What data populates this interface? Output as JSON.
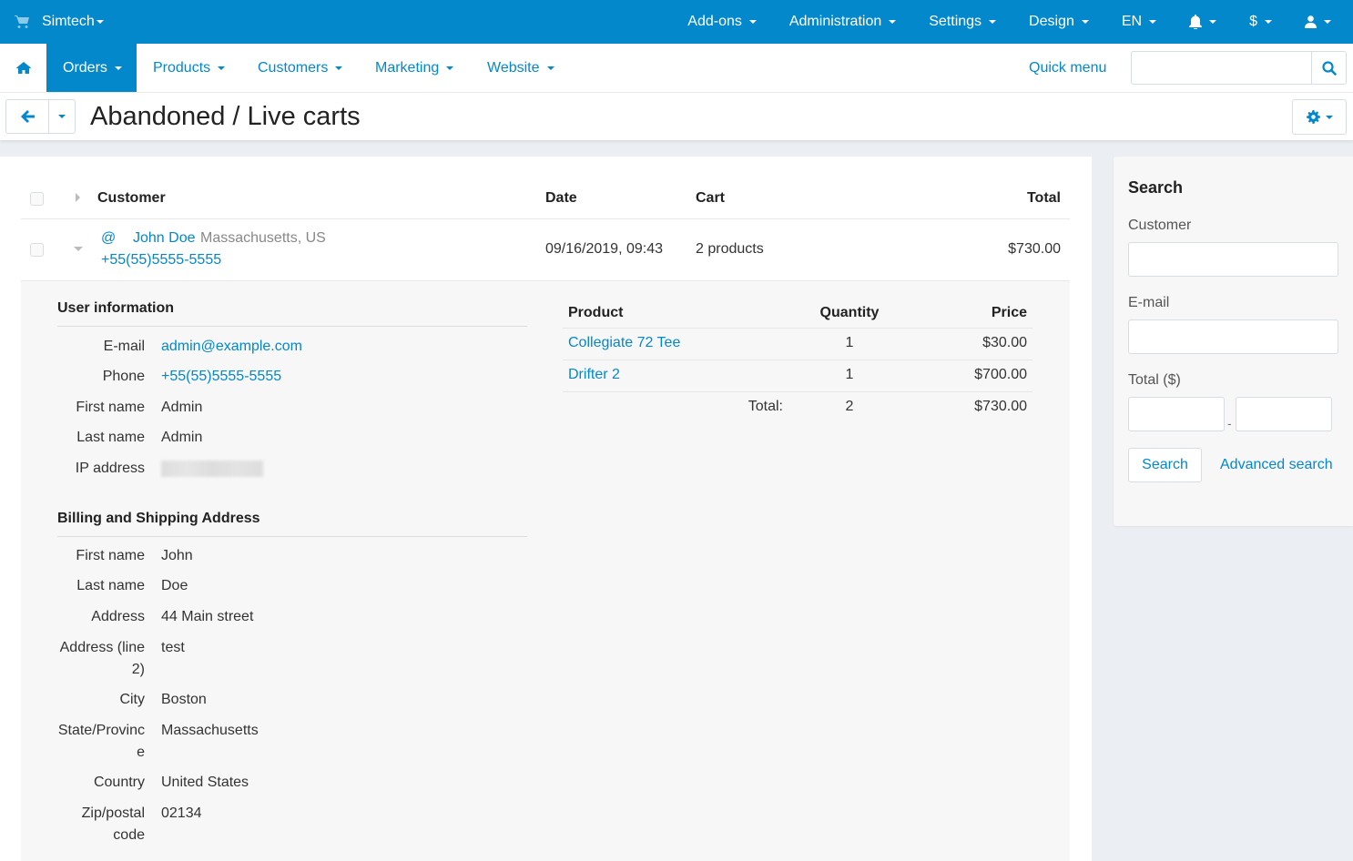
{
  "topbar": {
    "brand": "Simtech",
    "menu": [
      {
        "label": "Add-ons"
      },
      {
        "label": "Administration"
      },
      {
        "label": "Settings"
      },
      {
        "label": "Design"
      },
      {
        "label": "EN"
      }
    ],
    "icons": [
      "bell-icon",
      "currency-icon",
      "user-icon"
    ],
    "currency_symbol": "$"
  },
  "nav": {
    "items": [
      {
        "label": "Orders",
        "active": true
      },
      {
        "label": "Products"
      },
      {
        "label": "Customers"
      },
      {
        "label": "Marketing"
      },
      {
        "label": "Website"
      }
    ],
    "quick_menu": "Quick menu",
    "search_placeholder": ""
  },
  "page": {
    "title": "Abandoned / Live carts"
  },
  "table": {
    "headers": {
      "customer": "Customer",
      "date": "Date",
      "cart": "Cart",
      "total": "Total"
    },
    "rows": [
      {
        "email_icon": "@",
        "name": "John Doe",
        "location": "Massachusetts, US",
        "phone": "+55(55)5555-5555",
        "date": "09/16/2019, 09:43",
        "cart": "2 products",
        "total": "$730.00",
        "expanded": true
      }
    ]
  },
  "details": {
    "user_info": {
      "title": "User information",
      "fields": [
        {
          "label": "E-mail",
          "value": "admin@example.com",
          "link": true
        },
        {
          "label": "Phone",
          "value": "+55(55)5555-5555",
          "link": true
        },
        {
          "label": "First name",
          "value": "Admin"
        },
        {
          "label": "Last name",
          "value": "Admin"
        },
        {
          "label": "IP address",
          "value": "",
          "blurred": true
        }
      ]
    },
    "address": {
      "title": "Billing and Shipping Address",
      "fields": [
        {
          "label": "First name",
          "value": "John"
        },
        {
          "label": "Last name",
          "value": "Doe"
        },
        {
          "label": "Address",
          "value": "44 Main street"
        },
        {
          "label": "Address (line 2)",
          "value": "test"
        },
        {
          "label": "City",
          "value": "Boston"
        },
        {
          "label": "State/Province",
          "value": "Massachusetts"
        },
        {
          "label": "Country",
          "value": "United States"
        },
        {
          "label": "Zip/postal code",
          "value": "02134"
        }
      ]
    },
    "products": {
      "headers": {
        "product": "Product",
        "quantity": "Quantity",
        "price": "Price"
      },
      "items": [
        {
          "name": "Collegiate 72 Tee",
          "quantity": "1",
          "price": "$30.00"
        },
        {
          "name": "Drifter 2",
          "quantity": "1",
          "price": "$700.00"
        }
      ],
      "total_label": "Total:",
      "total_quantity": "2",
      "total_price": "$730.00"
    }
  },
  "search_panel": {
    "title": "Search",
    "customer_label": "Customer",
    "customer_value": "",
    "email_label": "E-mail",
    "email_value": "",
    "total_label": "Total ($)",
    "total_from": "",
    "total_to": "",
    "range_separator": "-",
    "search_button": "Search",
    "advanced_link": "Advanced search"
  },
  "colors": {
    "accent": "#0388cc",
    "page_bg": "#ebeff3",
    "panel_bg": "#f7f7f7"
  }
}
